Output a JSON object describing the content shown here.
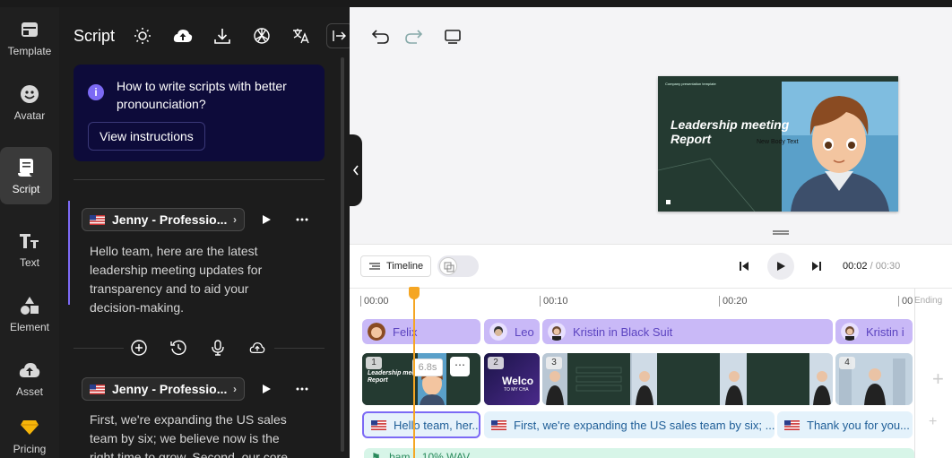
{
  "rail": {
    "items": [
      {
        "label": "Template",
        "icon": "template-icon"
      },
      {
        "label": "Avatar",
        "icon": "avatar-icon"
      },
      {
        "label": "Script",
        "icon": "script-icon",
        "active": true
      },
      {
        "label": "Text",
        "icon": "text-icon"
      },
      {
        "label": "Element",
        "icon": "element-icon"
      },
      {
        "label": "Asset",
        "icon": "asset-icon"
      },
      {
        "label": "Pricing",
        "icon": "diamond-icon"
      }
    ]
  },
  "panel": {
    "title": "Script",
    "header_icons": [
      "lightbulb-icon",
      "cloud-upload-icon",
      "download-icon",
      "openai-icon",
      "translate-icon"
    ],
    "tip": {
      "text": "How to write scripts with better pronounciation?",
      "button": "View instructions"
    },
    "blocks": [
      {
        "voice": "Jenny - Professio...",
        "text": "Hello team, here are the latest leadership meeting updates for transparency and to aid your decision-making."
      },
      {
        "voice": "Jenny - Professio...",
        "text": "First, we're expanding the US sales team by six; we believe now is the right time to grow. Second, our core"
      }
    ]
  },
  "preview": {
    "header_left": "Company presentation template",
    "header_right": "11/2023",
    "title": "Leadership meeting Report",
    "body": "New Body Text"
  },
  "controls": {
    "timeline_label": "Timeline",
    "current_time": "00:02",
    "total_time": "/ 00:30"
  },
  "timeline": {
    "ruler": [
      "00:00",
      "00:10",
      "00:20",
      "00"
    ],
    "ending_label": "Ending",
    "avatar_track": [
      {
        "name": "Felix"
      },
      {
        "name": "Leo"
      },
      {
        "name": "Kristin in Black Suit"
      },
      {
        "name": "Kristin i"
      }
    ],
    "scenes": [
      {
        "num": "1",
        "duration": "6.8s",
        "title": "Leadership meeting Report"
      },
      {
        "num": "2",
        "title": "Welcome TO MY CHA"
      },
      {
        "num": "3"
      },
      {
        "num": "4"
      }
    ],
    "script_track": [
      "Hello team, her...",
      "First, we're expanding the US sales team by six; ...",
      "Thank you for you..."
    ],
    "music_label": "bam... 10% WAV"
  },
  "colors": {
    "accent": "#7c6af5",
    "playhead": "#f5a623",
    "avatar_track": "#c9b9f7",
    "script_track": "#e4f2fb"
  }
}
